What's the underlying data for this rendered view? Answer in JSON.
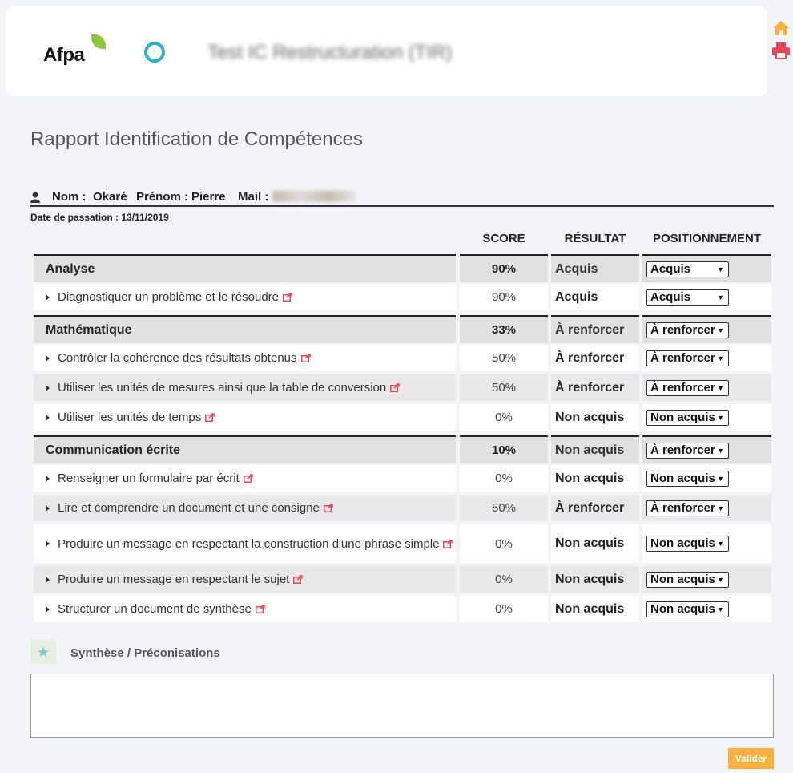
{
  "header": {
    "logo_text": "Afpa",
    "test_title": "Test IC Restructuration (TIR)"
  },
  "page_title": "Rapport Identification de Compétences",
  "user": {
    "nom_label": "Nom :",
    "nom": "Okaré",
    "prenom_label": "Prénom :",
    "prenom": "Pierre",
    "mail_label": "Mail :",
    "date_label": "Date de passation :",
    "date": "13/11/2019"
  },
  "columns": {
    "score": "SCORE",
    "resultat": "RÉSULTAT",
    "positionnement": "POSITIONNEMENT"
  },
  "rows": [
    {
      "type": "cat",
      "name": "Analyse",
      "score": "90%",
      "resultat": "Acquis",
      "position": "Acquis"
    },
    {
      "type": "sub",
      "name": "Diagnostiquer un problème et le résoudre",
      "score": "90%",
      "resultat": "Acquis",
      "position": "Acquis"
    },
    {
      "type": "cat",
      "name": "Mathématique",
      "score": "33%",
      "resultat": "À renforcer",
      "position": "À renforcer"
    },
    {
      "type": "sub",
      "name": "Contrôler la cohérence des résultats obtenus",
      "score": "50%",
      "resultat": "À renforcer",
      "position": "À renforcer"
    },
    {
      "type": "sub",
      "name": "Utiliser les unités de mesures ainsi que la table de conversion",
      "score": "50%",
      "resultat": "À renforcer",
      "position": "À renforcer"
    },
    {
      "type": "sub",
      "name": "Utiliser les unités de temps",
      "score": "0%",
      "resultat": "Non acquis",
      "position": "Non acquis"
    },
    {
      "type": "cat",
      "name": "Communication écrite",
      "score": "10%",
      "resultat": "Non acquis",
      "position": "À renforcer"
    },
    {
      "type": "sub",
      "name": "Renseigner un formulaire par écrit",
      "score": "0%",
      "resultat": "Non acquis",
      "position": "Non acquis"
    },
    {
      "type": "sub",
      "name": "Lire et comprendre un document et une consigne",
      "score": "50%",
      "resultat": "À renforcer",
      "position": "À renforcer"
    },
    {
      "type": "sub",
      "name": "Produire un message en respectant la construction d'une phrase simple",
      "score": "0%",
      "resultat": "Non acquis",
      "position": "Non acquis"
    },
    {
      "type": "sub",
      "name": "Produire un message en respectant le sujet",
      "score": "0%",
      "resultat": "Non acquis",
      "position": "Non acquis"
    },
    {
      "type": "sub",
      "name": "Structurer un document de synthèse",
      "score": "0%",
      "resultat": "Non acquis",
      "position": "Non acquis"
    }
  ],
  "synthese": {
    "label": "Synthèse / Préconisations",
    "value": ""
  },
  "valider_label": "Valider",
  "colors": {
    "accent_orange": "#fbb03b",
    "print_red": "#e8475a",
    "share_red": "#e8475a",
    "ring_blue": "#2ab3c9",
    "leaf_green": "#8dc63f"
  },
  "icons": [
    "home-icon",
    "print-icon",
    "user-icon",
    "share-icon",
    "star-icon",
    "caret-right-icon",
    "dropdown-arrow-icon"
  ]
}
